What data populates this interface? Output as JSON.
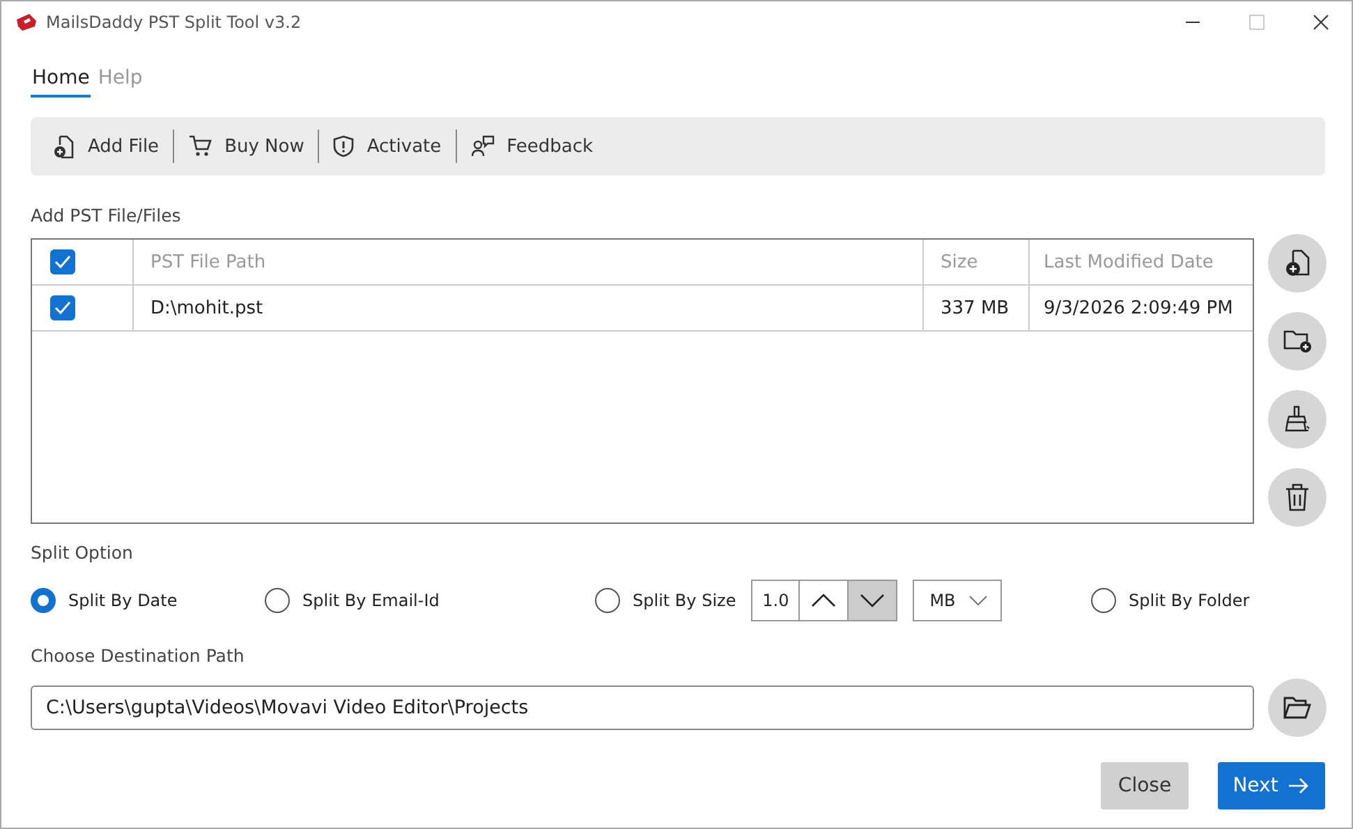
{
  "window": {
    "title": "MailsDaddy PST Split Tool v3.2"
  },
  "tabs": [
    {
      "label": "Home",
      "selected": true
    },
    {
      "label": "Help",
      "selected": false
    }
  ],
  "toolbar": [
    {
      "label": "Add File",
      "kind": "file"
    },
    {
      "label": "Buy Now",
      "kind": "cart"
    },
    {
      "label": "Activate",
      "kind": "shield"
    },
    {
      "label": "Feedback",
      "kind": "feedback"
    }
  ],
  "files_section": {
    "label": "Add PST File/Files"
  },
  "table": {
    "header_checked": true,
    "columns": [
      "PST File Path",
      "Size",
      "Last Modified Date"
    ],
    "rows": [
      {
        "checked": true,
        "cells": [
          "D:\\mohit.pst",
          "337 MB",
          "9/3/2026 2:09:49 PM"
        ]
      }
    ]
  },
  "split_option": {
    "label": "Split Option",
    "options": [
      {
        "label": "Split By Date",
        "selected": true,
        "kind": "plain"
      },
      {
        "label": "Split By Email-Id",
        "selected": false,
        "kind": "plain"
      },
      {
        "label": "Split By Size",
        "selected": false,
        "kind": "size"
      },
      {
        "label": "Split By Folder",
        "selected": false,
        "kind": "plain"
      }
    ],
    "size_value": "1.0",
    "size_unit": "MB"
  },
  "destination": {
    "label": "Choose Destination Path",
    "value": "C:\\Users\\gupta\\Videos\\Movavi Video Editor\\Projects"
  },
  "buttons": [
    {
      "label": "Close",
      "kind": "secondary"
    },
    {
      "label": "Next",
      "kind": "primary"
    }
  ]
}
